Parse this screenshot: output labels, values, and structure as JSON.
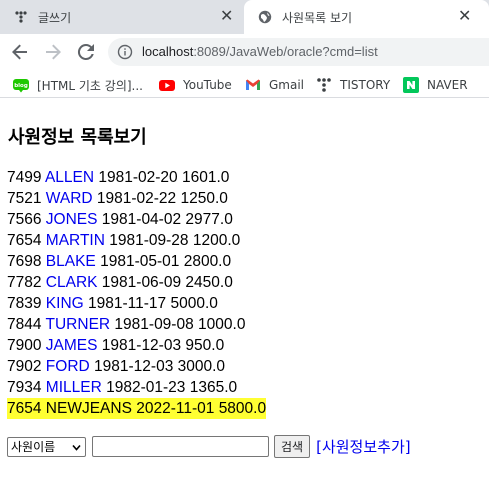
{
  "browser": {
    "tabs": [
      {
        "title": "글쓰기",
        "active": false,
        "icon": "tistory-dots-icon"
      },
      {
        "title": "사원목록 보기",
        "active": true,
        "icon": "globe-icon"
      }
    ],
    "close_glyph": "✕",
    "url": {
      "host": "localhost",
      "rest": ":8089/JavaWeb/oracle?cmd=list"
    },
    "bookmarks": [
      {
        "label": "[HTML 기초 강의]...",
        "icon": "blog-icon"
      },
      {
        "label": "YouTube",
        "icon": "youtube-icon"
      },
      {
        "label": "Gmail",
        "icon": "gmail-icon"
      },
      {
        "label": "TISTORY",
        "icon": "tistory-icon"
      },
      {
        "label": "NAVER",
        "icon": "naver-icon"
      }
    ]
  },
  "page": {
    "title": "사원정보 목록보기",
    "employees": [
      {
        "empno": "7499",
        "name": "ALLEN",
        "date": "1981-02-20",
        "sal": "1601.0",
        "highlighted": false
      },
      {
        "empno": "7521",
        "name": "WARD",
        "date": "1981-02-22",
        "sal": "1250.0",
        "highlighted": false
      },
      {
        "empno": "7566",
        "name": "JONES",
        "date": "1981-04-02",
        "sal": "2977.0",
        "highlighted": false
      },
      {
        "empno": "7654",
        "name": "MARTIN",
        "date": "1981-09-28",
        "sal": "1200.0",
        "highlighted": false
      },
      {
        "empno": "7698",
        "name": "BLAKE",
        "date": "1981-05-01",
        "sal": "2800.0",
        "highlighted": false
      },
      {
        "empno": "7782",
        "name": "CLARK",
        "date": "1981-06-09",
        "sal": "2450.0",
        "highlighted": false
      },
      {
        "empno": "7839",
        "name": "KING",
        "date": "1981-11-17",
        "sal": "5000.0",
        "highlighted": false
      },
      {
        "empno": "7844",
        "name": "TURNER",
        "date": "1981-09-08",
        "sal": "1000.0",
        "highlighted": false
      },
      {
        "empno": "7900",
        "name": "JAMES",
        "date": "1981-12-03",
        "sal": "950.0",
        "highlighted": false
      },
      {
        "empno": "7902",
        "name": "FORD",
        "date": "1981-12-03",
        "sal": "3000.0",
        "highlighted": false
      },
      {
        "empno": "7934",
        "name": "MILLER",
        "date": "1982-01-23",
        "sal": "1365.0",
        "highlighted": false
      },
      {
        "empno": "7654",
        "name": "NEWJEANS",
        "date": "2022-11-01",
        "sal": "5800.0",
        "highlighted": true
      }
    ],
    "search": {
      "select_value": "사원이름",
      "input_value": "",
      "button_label": "검색",
      "add_link_label": "[사원정보추가]"
    }
  },
  "colors": {
    "link": "#0000ee",
    "highlight": "#ffff33",
    "tab_strip": "#dee1e6"
  }
}
